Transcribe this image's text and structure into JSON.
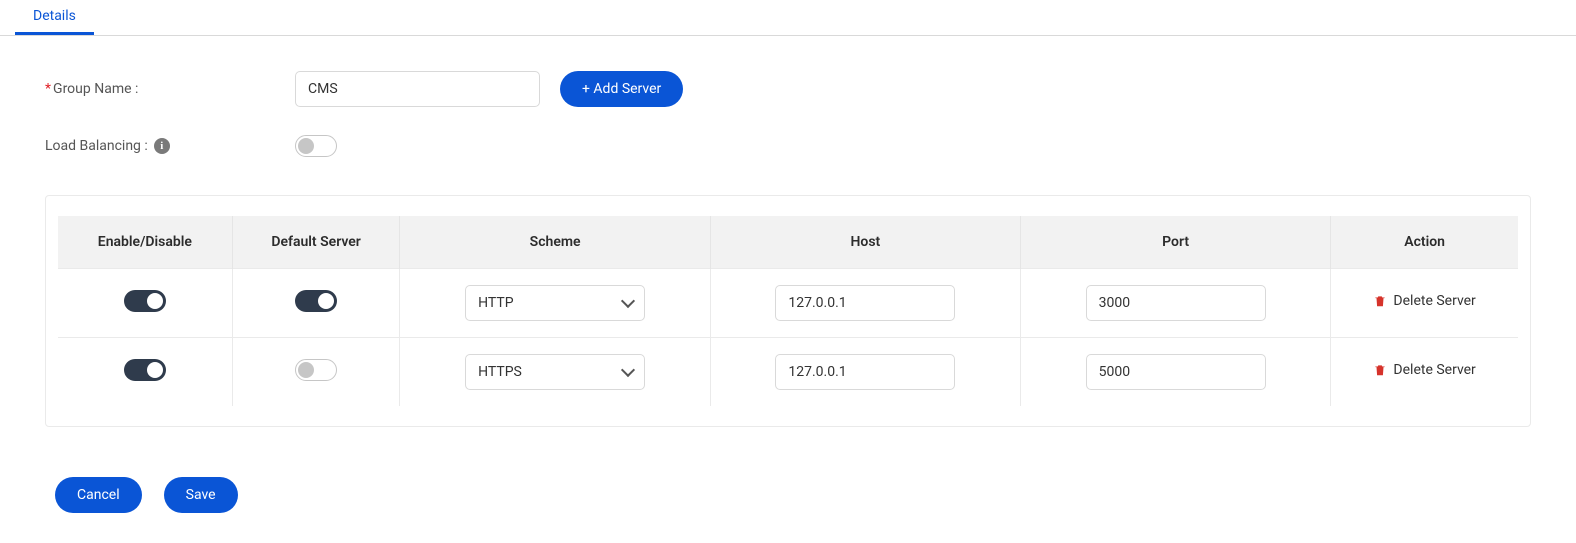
{
  "tabs": {
    "details": "Details"
  },
  "form": {
    "groupNameLabel": "Group Name :",
    "groupNameValue": "CMS",
    "addServerLabel": "+ Add Server",
    "loadBalancingLabel": "Load Balancing :"
  },
  "table": {
    "headers": {
      "enable": "Enable/Disable",
      "default": "Default Server",
      "scheme": "Scheme",
      "host": "Host",
      "port": "Port",
      "action": "Action"
    },
    "rows": [
      {
        "enabled": true,
        "default": true,
        "scheme": "HTTP",
        "host": "127.0.0.1",
        "port": "3000",
        "action": "Delete Server"
      },
      {
        "enabled": true,
        "default": false,
        "scheme": "HTTPS",
        "host": "127.0.0.1",
        "port": "5000",
        "action": "Delete Server"
      }
    ]
  },
  "buttons": {
    "cancel": "Cancel",
    "save": "Save"
  }
}
